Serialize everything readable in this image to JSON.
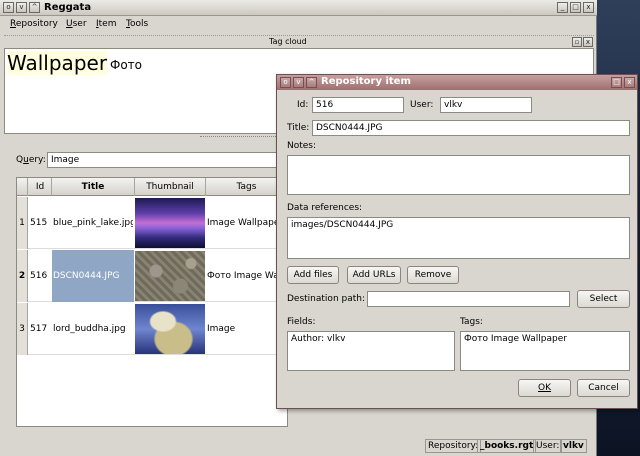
{
  "main_window": {
    "title": "Reggata",
    "menu": [
      "Repository",
      "User",
      "Item",
      "Tools"
    ],
    "tag_cloud": {
      "title": "Tag cloud",
      "tags": [
        "Wallpaper",
        "Фото"
      ]
    },
    "query": {
      "label": "Query:",
      "value": "Image"
    },
    "table": {
      "columns": [
        "Id",
        "Title",
        "Thumbnail",
        "Tags"
      ],
      "rows": [
        {
          "num": "1",
          "id": "515",
          "title": "blue_pink_lake.jpg",
          "tags": "Image Wallpaper"
        },
        {
          "num": "2",
          "id": "516",
          "title": "DSCN0444.JPG",
          "tags": "Фото Image Wa"
        },
        {
          "num": "3",
          "id": "517",
          "title": "lord_buddha.jpg",
          "tags": "Image"
        }
      ]
    },
    "status": {
      "repository_label": "Repository:",
      "repository_value": "_books.rgt",
      "user_label": "User:",
      "user_value": "vlkv"
    }
  },
  "dialog": {
    "title": "Repository item",
    "id_label": "Id:",
    "id_value": "516",
    "user_label": "User:",
    "user_value": "vlkv",
    "title_label": "Title:",
    "title_value": "DSCN0444.JPG",
    "notes_label": "Notes:",
    "notes_value": "",
    "data_refs_label": "Data references:",
    "data_refs_value": "images/DSCN0444.JPG",
    "add_files": "Add files",
    "add_urls": "Add URLs",
    "remove": "Remove",
    "dest_label": "Destination path:",
    "dest_value": "",
    "select": "Select",
    "fields_label": "Fields:",
    "fields_value": "Author: vlkv",
    "tags_label": "Tags:",
    "tags_value": "Фото Image Wallpaper",
    "ok": "OK",
    "cancel": "Cancel"
  }
}
